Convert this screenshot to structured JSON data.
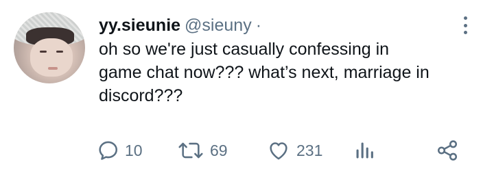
{
  "tweet": {
    "display_name": "yy.sieunie",
    "handle": "@sieuny",
    "separator": "·",
    "text": "oh so we're just casually confessing in\ngame chat now??? what’s next, marriage in\ndiscord???",
    "avatar_icon": "user-avatar-photo"
  },
  "actions": {
    "reply": {
      "icon": "reply-icon",
      "count": "10"
    },
    "retweet": {
      "icon": "retweet-icon",
      "count": "69"
    },
    "like": {
      "icon": "heart-icon",
      "count": "231"
    },
    "analytics": {
      "icon": "analytics-icon"
    },
    "share": {
      "icon": "share-icon"
    }
  },
  "colors": {
    "text": "#0f1419",
    "secondary": "#5b7083",
    "background": "#ffffff"
  }
}
